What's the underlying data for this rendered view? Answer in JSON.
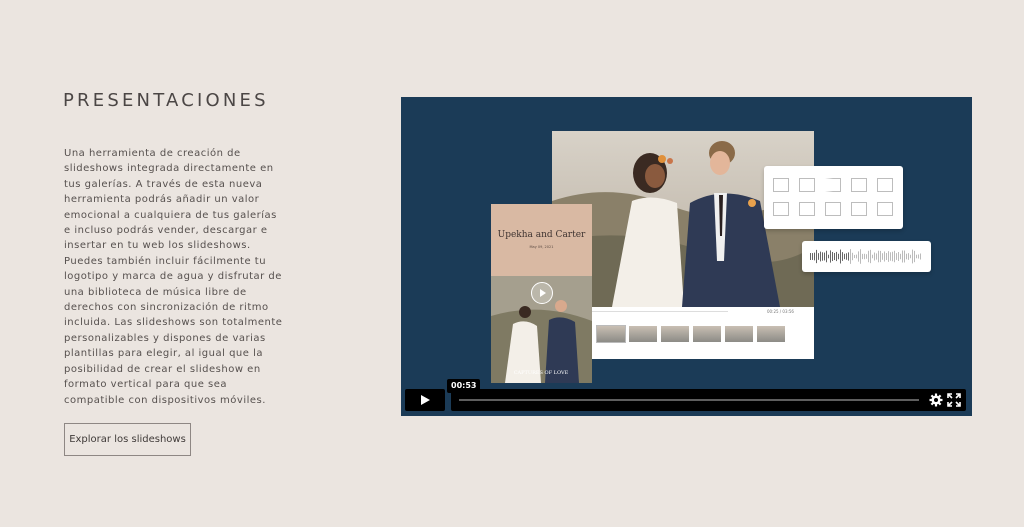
{
  "section": {
    "title": "PRESENTACIONES",
    "description": "Una herramienta de creación de slideshows integrada directamente en tus galerías. A través de esta nueva herramienta podrás añadir un valor emocional a cualquiera de tus galerías e incluso podrás vender, descargar e insertar en tu web los slideshows. Puedes también incluir fácilmente tu logotipo y marca de agua y disfrutar de una biblioteca de música libre de derechos con sincronización de ritmo incluida. Las slideshows son totalmente personalizables y dispones de varias plantillas para elegir, al igual que la posibilidad de crear el slideshow en formato vertical para que sea compatible con dispositivos móviles.",
    "cta_label": "Explorar los slideshows"
  },
  "video": {
    "current_time": "00:53",
    "story_title": "Upekha and Carter",
    "story_date": "May 09, 2021",
    "story_caption": "CAPTURES OF LOVE",
    "mini_player_time": "00:25 / 03:56",
    "progress_fraction": 0.03
  },
  "colors": {
    "page_bg": "#ebe5e0",
    "video_bg": "#1b3b57",
    "story_accent": "#d9b9a3"
  },
  "icons": {
    "play": "play-icon",
    "settings": "gear-icon",
    "fullscreen": "fullscreen-icon"
  }
}
